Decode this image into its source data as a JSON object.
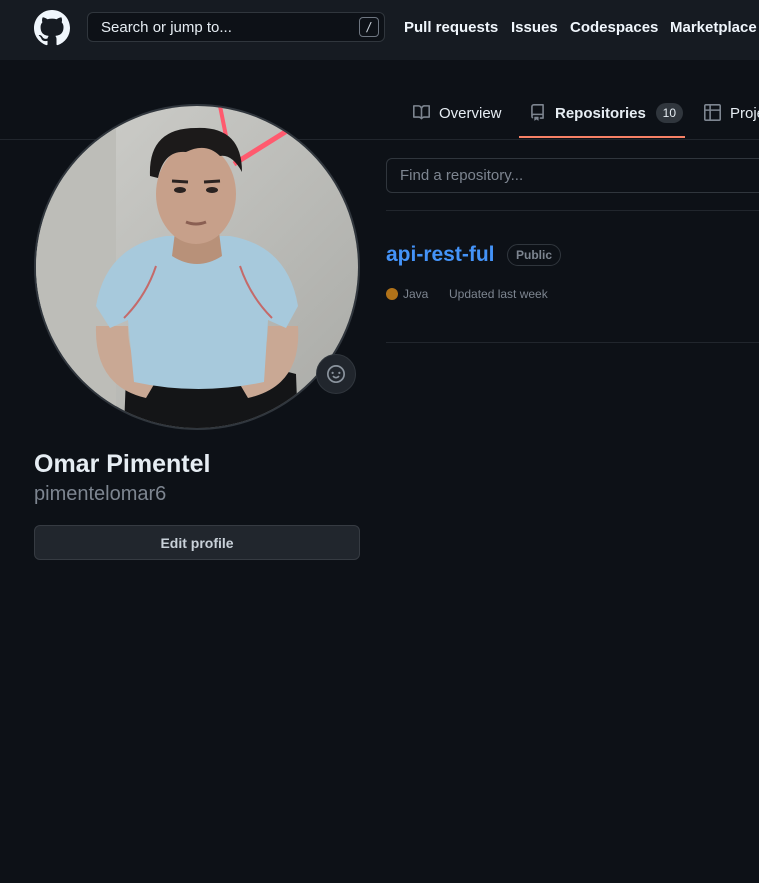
{
  "header": {
    "search_placeholder": "Search or jump to...",
    "search_shortcut": "/",
    "nav": {
      "pull_requests": "Pull requests",
      "issues": "Issues",
      "codespaces": "Codespaces",
      "marketplace": "Marketplace"
    }
  },
  "tabs": {
    "overview": "Overview",
    "repositories": "Repositories",
    "repositories_count": "10",
    "projects": "Proje"
  },
  "profile": {
    "full_name": "Omar Pimentel",
    "username": "pimentelomar6",
    "edit_button": "Edit profile"
  },
  "repos": {
    "find_placeholder": "Find a repository...",
    "items": [
      {
        "name": "api-rest-ful",
        "visibility": "Public",
        "language": "Java",
        "language_color": "#b07219",
        "updated": "Updated last week"
      }
    ]
  },
  "colors": {
    "accent_link": "#4493f8",
    "tab_underline": "#f78166",
    "background": "#0d1117"
  }
}
